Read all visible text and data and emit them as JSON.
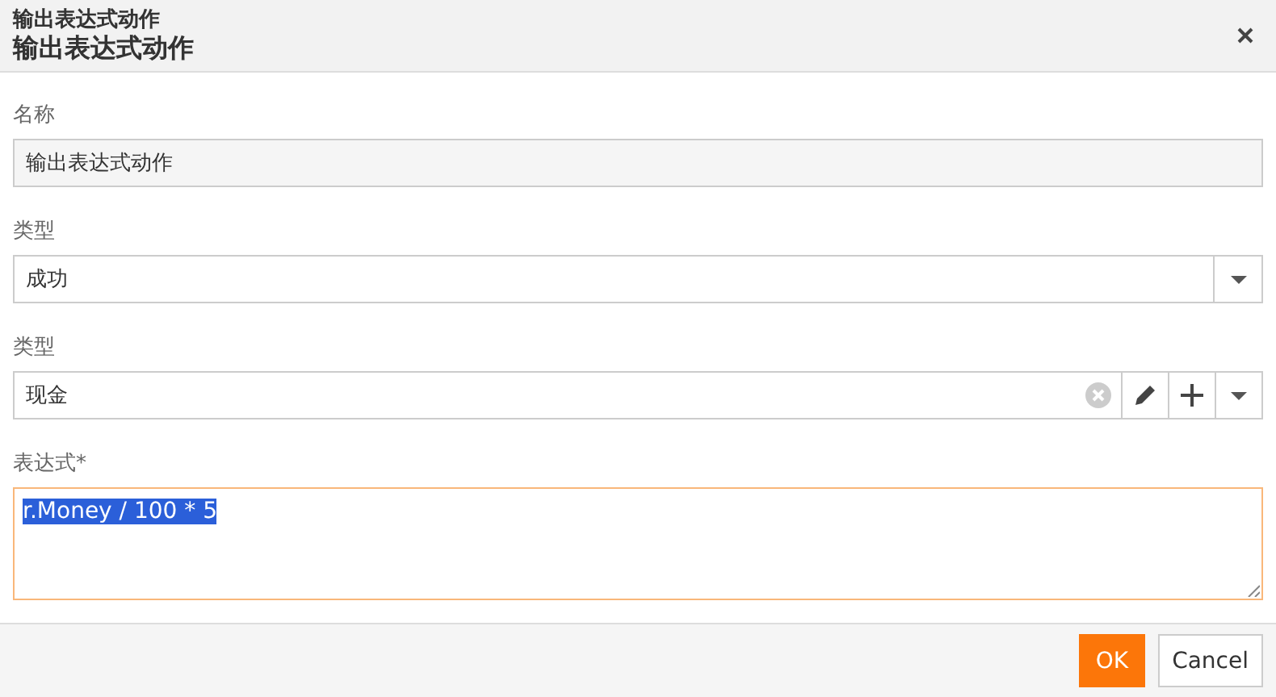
{
  "window": {
    "subtitle": "输出表达式动作",
    "title": "输出表达式动作"
  },
  "fields": [
    {
      "kind": "readonly",
      "label": "名称",
      "value": "输出表达式动作"
    },
    {
      "kind": "select",
      "label": "类型",
      "value": "成功"
    },
    {
      "kind": "combo",
      "label": "类型",
      "value": "现金"
    },
    {
      "kind": "textarea",
      "label": "表达式*",
      "value": "r.Money / 100 * 5",
      "text_selected": true,
      "focused": true
    }
  ],
  "buttons": [
    {
      "label": "OK",
      "kind": "primary"
    },
    {
      "label": "Cancel",
      "kind": "default"
    }
  ]
}
